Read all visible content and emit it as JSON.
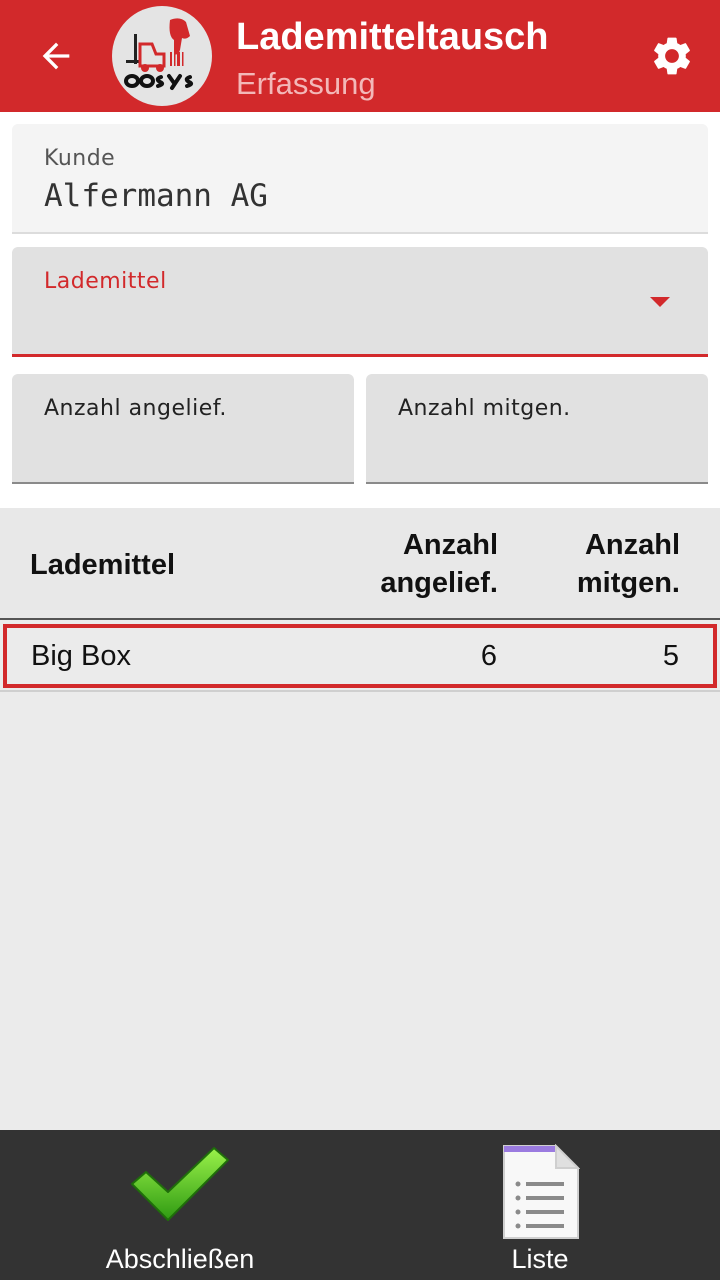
{
  "appbar": {
    "title": "Lademitteltausch",
    "subtitle": "Erfassung",
    "logo_text": "COSYS",
    "back_icon": "arrow-back-icon",
    "settings_icon": "gear-icon"
  },
  "form": {
    "kunde": {
      "label": "Kunde",
      "value": "Alfermann AG"
    },
    "lademittel": {
      "label": "Lademittel",
      "value": ""
    },
    "anzahl_angeliefert": {
      "label": "Anzahl angelief.",
      "value": ""
    },
    "anzahl_mitgenommen": {
      "label": "Anzahl mitgen.",
      "value": ""
    }
  },
  "table": {
    "headers": {
      "name": "Lademittel",
      "delivered_line1": "Anzahl",
      "delivered_line2": "angelief.",
      "returned_line1": "Anzahl",
      "returned_line2": "mitgen."
    },
    "rows": [
      {
        "name": "Big Box",
        "delivered": "6",
        "returned": "5"
      }
    ]
  },
  "bottombar": {
    "finish_label": "Abschließen",
    "finish_icon": "checkmark-icon",
    "list_label": "Liste",
    "list_icon": "document-list-icon"
  },
  "colors": {
    "primary": "#d2292b",
    "bottombar": "#333333",
    "field_bg": "#e1e1e1",
    "table_bg": "#ebebeb"
  }
}
